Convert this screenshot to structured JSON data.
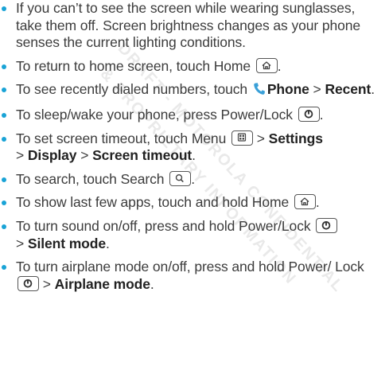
{
  "watermark": {
    "line1": "DRAFT - MOTOROLA CONFIDENTIAL",
    "line2": "& PROPRIETARY INFORMATION"
  },
  "tips": [
    {
      "text1": "If you can’t to see the screen while wearing sunglasses, take them off. Screen brightness changes as your phone senses the current lighting conditions."
    },
    {
      "text1": "To return to home screen, touch Home ",
      "key_icon": "home-icon",
      "text2": "."
    },
    {
      "text1": "To see recently dialed numbers, touch ",
      "icon": "phone-icon",
      "bold1": "Phone",
      "sep": " > ",
      "bold2": "Recent",
      "end": "."
    },
    {
      "text1": "To sleep/wake your phone, press Power/Lock ",
      "key_icon": "power-icon",
      "text2": "."
    },
    {
      "text1": "To set screen timeout, touch Menu ",
      "key_icon": "menu-icon",
      "sep1": " > ",
      "bold1": "Settings",
      "sep2": " > ",
      "bold2": "Display",
      "sep3": " > ",
      "bold3": "Screen timeout",
      "end": "."
    },
    {
      "text1": "To search, touch Search ",
      "key_icon": "search-icon",
      "text2": "."
    },
    {
      "text1": "To show last few apps, touch and hold Home ",
      "key_icon": "home-icon",
      "text2": "."
    },
    {
      "text1": "To turn sound on/off, press and hold Power/Lock ",
      "key_icon": "power-icon",
      "sep": " > ",
      "bold1": "Silent mode",
      "end": "."
    },
    {
      "text1": "To turn airplane mode on/off, press and hold Power/ Lock ",
      "key_icon": "power-icon",
      "sep": " > ",
      "bold1": "Airplane mode",
      "end": "."
    }
  ],
  "colors": {
    "bullet": "#19a3d6",
    "text": "#3c3c3c",
    "phone_icon": "#3aa0d8"
  }
}
